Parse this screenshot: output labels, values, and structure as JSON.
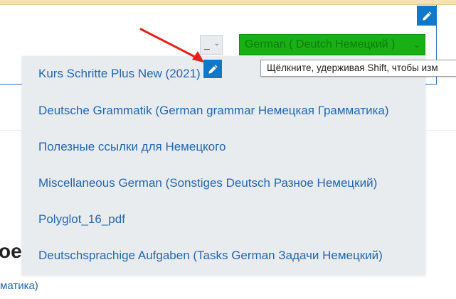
{
  "edit_icon": "pencil-icon",
  "language_picker": {
    "small_select_value": "_",
    "selected_label": "German ( Deutch Немецкий )"
  },
  "tooltip": {
    "text": "Щёлкните, удерживая Shift, чтобы изм"
  },
  "dropdown": {
    "items": [
      "Kurs Schritte Plus New (2021)",
      "Deutsche Grammatik (German grammar Немецкая Грамматика)",
      "Полезные ссылки для Немецкого",
      "Miscellaneous German (Sonstiges Deutsch Разное Немецкий)",
      "Polyglot_16_pdf",
      "Deutschsprachige Aufgaben (Tasks German Задачи Немецкий)"
    ]
  },
  "background": {
    "heading_fragment": "oe",
    "link_fragment": "матика)"
  },
  "colors": {
    "accent": "#1177c8",
    "green_select": "#18b014",
    "link": "#2266b3",
    "arrow": "#e8201a"
  }
}
